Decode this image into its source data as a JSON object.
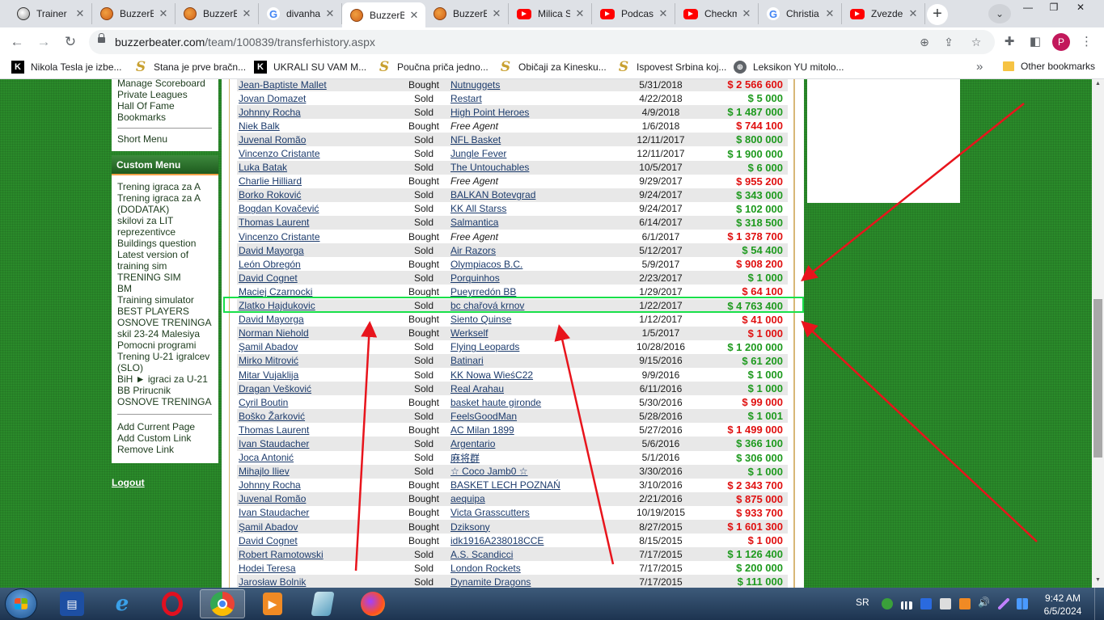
{
  "browser": {
    "tabs": [
      {
        "title": "Trainer",
        "icon": "ball-icon",
        "active": false
      },
      {
        "title": "BuzzerBeater",
        "icon": "buzzerbeater-icon",
        "active": false
      },
      {
        "title": "BuzzerBeater",
        "icon": "buzzerbeater-icon",
        "active": false
      },
      {
        "title": "divanhana",
        "icon": "google-icon",
        "active": false
      },
      {
        "title": "BuzzerBeater",
        "icon": "buzzerbeater-icon",
        "active": true
      },
      {
        "title": "BuzzerBeater",
        "icon": "buzzerbeater-icon",
        "active": false
      },
      {
        "title": "Milica S",
        "icon": "youtube-icon",
        "active": false
      },
      {
        "title": "Podcast",
        "icon": "youtube-icon",
        "active": false
      },
      {
        "title": "Checkm",
        "icon": "youtube-icon",
        "active": false
      },
      {
        "title": "Christia",
        "icon": "google-icon",
        "active": false
      },
      {
        "title": "Zvezde",
        "icon": "youtube-icon",
        "active": false
      }
    ],
    "new_tab": "+",
    "url_domain": "buzzerbeater.com",
    "url_path": "/team/100839/transferhistory.aspx",
    "profile_initial": "P",
    "bookmarks": [
      {
        "label": "Nikola Tesla je izbe...",
        "icon": "k-icon"
      },
      {
        "label": "Stana je prve bračn...",
        "icon": "s-icon"
      },
      {
        "label": "UKRALI SU VAM M...",
        "icon": "k-icon"
      },
      {
        "label": "Poučna priča jedno...",
        "icon": "s-icon"
      },
      {
        "label": "Običaji za Kinesku...",
        "icon": "s-icon"
      },
      {
        "label": "Ispovest Srbina koj...",
        "icon": "s-icon"
      },
      {
        "label": "Leksikon YU mitolo...",
        "icon": "globe-icon"
      }
    ],
    "other_bookmarks": "Other bookmarks"
  },
  "sidebar": {
    "top_links": [
      "Manage Scoreboard",
      "Private Leagues",
      "Hall Of Fame",
      "Bookmarks"
    ],
    "short_menu": "Short Menu",
    "custom_menu_title": "Custom Menu",
    "custom_links": [
      "Trening igraca za A",
      "Trening igraca za A",
      "(DODATAK)",
      "skilovi za LIT",
      "reprezentivce",
      "Buildings question",
      "Latest version of",
      "training sim",
      "TRENING SIM",
      "BM",
      "Training simulator",
      "BEST PLAYERS",
      "OSNOVE TRENINGA",
      "skil 23-24 Malesiya",
      "Pomocni programi",
      "Trening U-21 igralcev",
      "(SLO)",
      "BiH ► igraci za U-21",
      "BB Prirucnik",
      "OSNOVE TRENINGA"
    ],
    "actions": [
      "Add Current Page",
      "Add Custom Link",
      "Remove Link"
    ],
    "logout": "Logout"
  },
  "transfers": [
    {
      "player": "Jean-Baptiste Mallet",
      "type": "Bought",
      "team": "Nutnuggets",
      "date": "5/31/2018",
      "price": "$ 2 566 600",
      "free_agent": false
    },
    {
      "player": "Jovan Domazet",
      "type": "Sold",
      "team": "Restart",
      "date": "4/22/2018",
      "price": "$ 5 000",
      "free_agent": false
    },
    {
      "player": "Johnny Rocha",
      "type": "Sold",
      "team": "High Point Heroes",
      "date": "4/9/2018",
      "price": "$ 1 487 000",
      "free_agent": false
    },
    {
      "player": "Niek Balk",
      "type": "Bought",
      "team": "Free Agent",
      "date": "1/6/2018",
      "price": "$ 744 100",
      "free_agent": true
    },
    {
      "player": "Juvenal Romão",
      "type": "Sold",
      "team": "NFL Basket",
      "date": "12/11/2017",
      "price": "$ 800 000",
      "free_agent": false
    },
    {
      "player": "Vincenzo Cristante",
      "type": "Sold",
      "team": "Jungle Fever",
      "date": "12/11/2017",
      "price": "$ 1 900 000",
      "free_agent": false
    },
    {
      "player": "Luka Batak",
      "type": "Sold",
      "team": "The Untouchables",
      "date": "10/5/2017",
      "price": "$ 6 000",
      "free_agent": false
    },
    {
      "player": "Charlie Hilliard",
      "type": "Bought",
      "team": "Free Agent",
      "date": "9/29/2017",
      "price": "$ 955 200",
      "free_agent": true
    },
    {
      "player": "Borko Roković",
      "type": "Sold",
      "team": "BALKAN Botevgrad",
      "date": "9/24/2017",
      "price": "$ 343 000",
      "free_agent": false
    },
    {
      "player": "Bogdan Kovačević",
      "type": "Sold",
      "team": "KK All Starss",
      "date": "9/24/2017",
      "price": "$ 102 000",
      "free_agent": false
    },
    {
      "player": "Thomas Laurent",
      "type": "Sold",
      "team": "Salmantica",
      "date": "6/14/2017",
      "price": "$ 318 500",
      "free_agent": false
    },
    {
      "player": "Vincenzo Cristante",
      "type": "Bought",
      "team": "Free Agent",
      "date": "6/1/2017",
      "price": "$ 1 378 700",
      "free_agent": true
    },
    {
      "player": "David Mayorga",
      "type": "Sold",
      "team": "Air Razors",
      "date": "5/12/2017",
      "price": "$ 54 400",
      "free_agent": false
    },
    {
      "player": "León Obregón",
      "type": "Bought",
      "team": "Olympiacos B.C.",
      "date": "5/9/2017",
      "price": "$ 908 200",
      "free_agent": false
    },
    {
      "player": "David Cognet",
      "type": "Sold",
      "team": "Porquinhos",
      "date": "2/23/2017",
      "price": "$ 1 000",
      "free_agent": false
    },
    {
      "player": "Maciej Czarnocki",
      "type": "Bought",
      "team": "Pueyrredón BB",
      "date": "1/29/2017",
      "price": "$ 64 100",
      "free_agent": false
    },
    {
      "player": "Zlatko Hajdukovic",
      "type": "Sold",
      "team": "bc chařová krnov",
      "date": "1/22/2017",
      "price": "$ 4 763 400",
      "free_agent": false
    },
    {
      "player": "David Mayorga",
      "type": "Bought",
      "team": "Siento Quinse",
      "date": "1/12/2017",
      "price": "$ 41 000",
      "free_agent": false
    },
    {
      "player": "Norman Niehold",
      "type": "Bought",
      "team": "Werkself",
      "date": "1/5/2017",
      "price": "$ 1 000",
      "free_agent": false
    },
    {
      "player": "Şamil Abadov",
      "type": "Sold",
      "team": "Flying Leopards",
      "date": "10/28/2016",
      "price": "$ 1 200 000",
      "free_agent": false
    },
    {
      "player": "Mirko Mitrović",
      "type": "Sold",
      "team": "Batinari",
      "date": "9/15/2016",
      "price": "$ 61 200",
      "free_agent": false
    },
    {
      "player": "Mitar Vujaklija",
      "type": "Sold",
      "team": "KK Nowa WieśC22",
      "date": "9/9/2016",
      "price": "$ 1 000",
      "free_agent": false
    },
    {
      "player": "Dragan Vešković",
      "type": "Sold",
      "team": "Real Arahau",
      "date": "6/11/2016",
      "price": "$ 1 000",
      "free_agent": false
    },
    {
      "player": "Cyril Boutin",
      "type": "Bought",
      "team": "basket haute gironde",
      "date": "5/30/2016",
      "price": "$ 99 000",
      "free_agent": false
    },
    {
      "player": "Boško Žarković",
      "type": "Sold",
      "team": "FeelsGoodMan",
      "date": "5/28/2016",
      "price": "$ 1 001",
      "free_agent": false
    },
    {
      "player": "Thomas Laurent",
      "type": "Bought",
      "team": "AC Milan 1899",
      "date": "5/27/2016",
      "price": "$ 1 499 000",
      "free_agent": false
    },
    {
      "player": "Ivan Staudacher",
      "type": "Sold",
      "team": "Argentario",
      "date": "5/6/2016",
      "price": "$ 366 100",
      "free_agent": false
    },
    {
      "player": "Joca Antonić",
      "type": "Sold",
      "team": "麻将群",
      "date": "5/1/2016",
      "price": "$ 306 000",
      "free_agent": false
    },
    {
      "player": "Mihajlo Iliev",
      "type": "Sold",
      "team": "☆ Coco Jamb0 ☆",
      "date": "3/30/2016",
      "price": "$ 1 000",
      "free_agent": false
    },
    {
      "player": "Johnny Rocha",
      "type": "Bought",
      "team": "BASKET LECH POZNAŃ",
      "date": "3/10/2016",
      "price": "$ 2 343 700",
      "free_agent": false
    },
    {
      "player": "Juvenal Romão",
      "type": "Bought",
      "team": "aequipa",
      "date": "2/21/2016",
      "price": "$ 875 000",
      "free_agent": false
    },
    {
      "player": "Ivan Staudacher",
      "type": "Bought",
      "team": "Victa Grasscutters",
      "date": "10/19/2015",
      "price": "$ 933 700",
      "free_agent": false
    },
    {
      "player": "Şamil Abadov",
      "type": "Bought",
      "team": "Dziksony",
      "date": "8/27/2015",
      "price": "$ 1 601 300",
      "free_agent": false
    },
    {
      "player": "David Cognet",
      "type": "Bought",
      "team": "idk1916A238018CCE",
      "date": "8/15/2015",
      "price": "$ 1 000",
      "free_agent": false
    },
    {
      "player": "Robert Ramotowski",
      "type": "Sold",
      "team": "A.S. Scandicci",
      "date": "7/17/2015",
      "price": "$ 1 126 400",
      "free_agent": false
    },
    {
      "player": "Hodei Teresa",
      "type": "Sold",
      "team": "London Rockets",
      "date": "7/17/2015",
      "price": "$ 200 000",
      "free_agent": false
    },
    {
      "player": "Jarosław Bolnik",
      "type": "Sold",
      "team": "Dynamite Dragons",
      "date": "7/17/2015",
      "price": "$ 111 000",
      "free_agent": false
    }
  ],
  "highlighted_player": "Zlatko Hajdukovic",
  "colors": {
    "sold": "#1e9a1e",
    "bought": "#e01010",
    "highlight": "#19e04a",
    "arrow": "#e8141c",
    "page_bg": "#2a8a2a"
  },
  "taskbar": {
    "apps": [
      "save-app-icon",
      "internet-explorer-icon",
      "opera-icon",
      "chrome-icon",
      "media-player-icon",
      "notes-icon",
      "firefox-icon"
    ],
    "language": "SR",
    "time": "9:42 AM",
    "date": "6/5/2024"
  }
}
